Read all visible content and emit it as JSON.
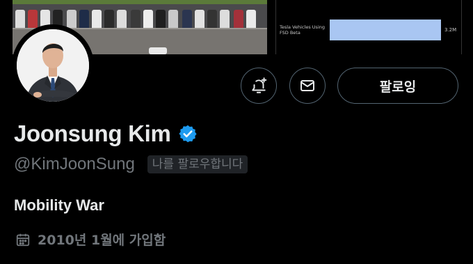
{
  "banner": {
    "chart_label": "Tesla Vehicles Using FSD Beta",
    "chart_value": "3.2M"
  },
  "profile": {
    "name": "Joonsung Kim",
    "handle": "@KimJoonSung",
    "follows_you": "나를 팔로우합니다",
    "bio": "Mobility War",
    "joined": "2010년 1월에 가입함",
    "verified_color": "#1d9bf0"
  },
  "actions": {
    "follow_label": "팔로잉"
  },
  "icons": {
    "notify": "bell-plus-icon",
    "message": "envelope-icon",
    "verified": "verified-badge-icon",
    "calendar": "calendar-icon"
  }
}
